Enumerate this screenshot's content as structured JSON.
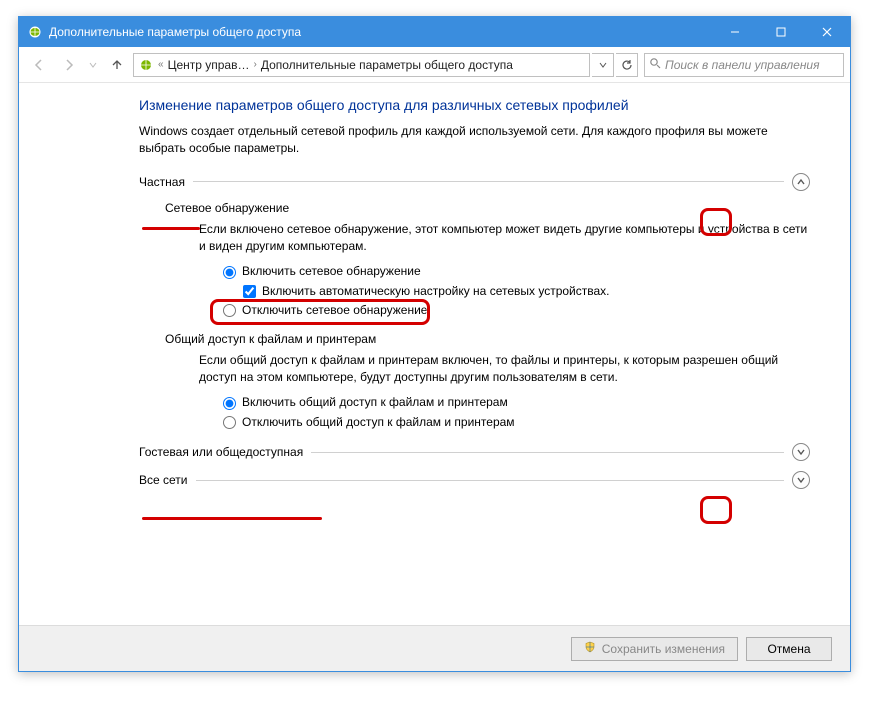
{
  "window": {
    "title": "Дополнительные параметры общего доступа"
  },
  "breadcrumb": {
    "level1": "Центр управ…",
    "level2": "Дополнительные параметры общего доступа"
  },
  "search": {
    "placeholder": "Поиск в панели управления"
  },
  "page": {
    "title": "Изменение параметров общего доступа для различных сетевых профилей",
    "desc": "Windows создает отдельный сетевой профиль для каждой используемой сети. Для каждого профиля вы можете выбрать особые параметры."
  },
  "profiles": {
    "private": {
      "label": "Частная",
      "discovery": {
        "heading": "Сетевое обнаружение",
        "desc": "Если включено сетевое обнаружение, этот компьютер может видеть другие компьютеры и устройства в сети и виден другим компьютерам.",
        "opt_on": "Включить сетевое обнаружение",
        "opt_auto": "Включить автоматическую настройку на сетевых устройствах.",
        "opt_off": "Отключить сетевое обнаружение"
      },
      "fileshare": {
        "heading": "Общий доступ к файлам и принтерам",
        "desc": "Если общий доступ к файлам и принтерам включен, то файлы и принтеры, к которым разрешен общий доступ на этом компьютере, будут доступны другим пользователям в сети.",
        "opt_on": "Включить общий доступ к файлам и принтерам",
        "opt_off": "Отключить общий доступ к файлам и принтерам"
      }
    },
    "guest": {
      "label": "Гостевая или общедоступная"
    },
    "all": {
      "label": "Все сети"
    }
  },
  "buttons": {
    "save": "Сохранить изменения",
    "cancel": "Отмена"
  }
}
